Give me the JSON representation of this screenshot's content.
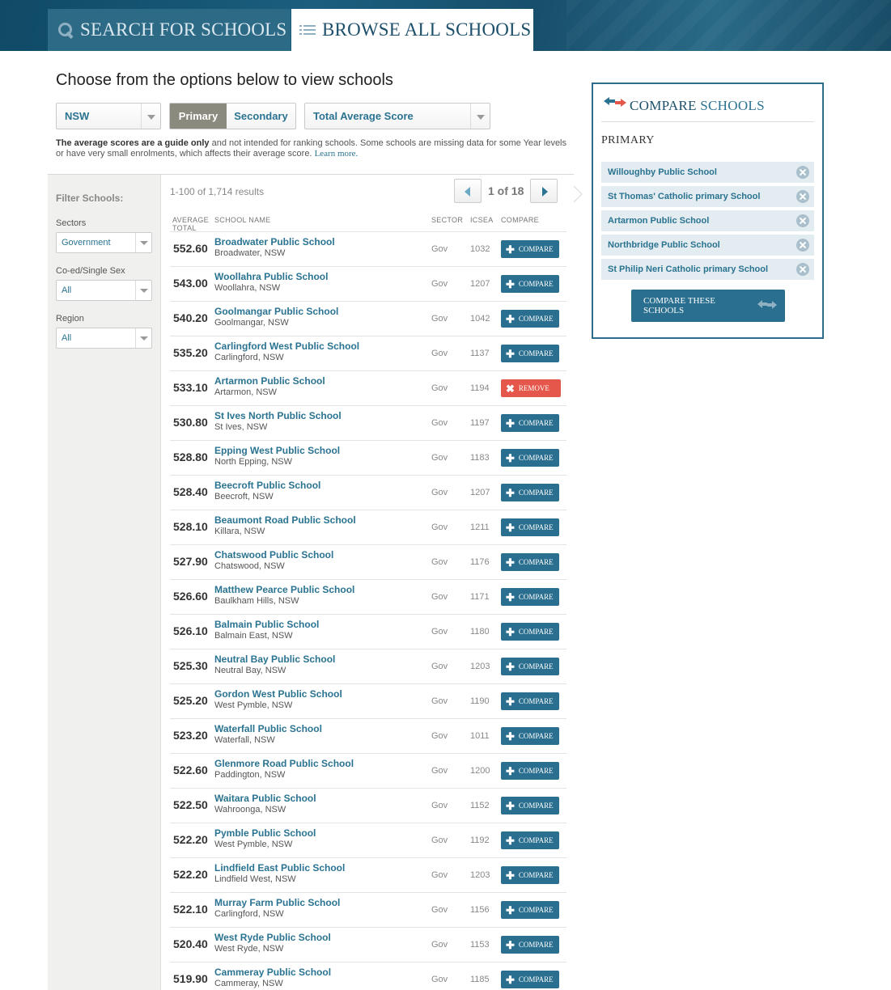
{
  "header": {
    "tabs": [
      {
        "label": "SEARCH FOR SCHOOLS",
        "icon": "search-icon",
        "active": false
      },
      {
        "label": "BROWSE ALL SCHOOLS",
        "icon": "list-icon",
        "active": true
      }
    ]
  },
  "main": {
    "title": "Choose from the options below to view schools",
    "state_select": "NSW",
    "level_toggle": {
      "primary": "Primary",
      "secondary": "Secondary",
      "selected": "Primary"
    },
    "score_select": "Total Average Score",
    "note": {
      "bold": "The average scores are a guide only",
      "rest": " and not intended for ranking schools. Some schools are missing data for some Year levels or have very small enrolments, which affects their average score. ",
      "link": "Learn more."
    }
  },
  "filters": {
    "title": "Filter Schools:",
    "sectors": {
      "label": "Sectors",
      "value": "Government"
    },
    "coed": {
      "label": "Co-ed/Single Sex",
      "value": "All"
    },
    "region": {
      "label": "Region",
      "value": "All"
    }
  },
  "results": {
    "count": "1-100 of 1,714 results",
    "page": "1 of 18",
    "headers": {
      "average_line1": "AVERAGE",
      "average_line2": "TOTAL",
      "name": "SCHOOL NAME",
      "sector": "SECTOR",
      "icsea": "ICSEA",
      "compare": "COMPARE"
    },
    "compare_label": "COMPARE",
    "remove_label": "REMOVE",
    "rows": [
      {
        "score": "552.60",
        "name": "Broadwater Public School",
        "loc": "Broadwater, NSW",
        "sector": "Gov",
        "icsea": "1032",
        "action": "COMPARE"
      },
      {
        "score": "543.00",
        "name": "Woollahra Public School",
        "loc": "Woollahra, NSW",
        "sector": "Gov",
        "icsea": "1207",
        "action": "COMPARE"
      },
      {
        "score": "540.20",
        "name": "Goolmangar Public School",
        "loc": "Goolmangar, NSW",
        "sector": "Gov",
        "icsea": "1042",
        "action": "COMPARE"
      },
      {
        "score": "535.20",
        "name": "Carlingford West Public School",
        "loc": "Carlingford, NSW",
        "sector": "Gov",
        "icsea": "1137",
        "action": "COMPARE"
      },
      {
        "score": "533.10",
        "name": "Artarmon Public School",
        "loc": "Artarmon, NSW",
        "sector": "Gov",
        "icsea": "1194",
        "action": "REMOVE"
      },
      {
        "score": "530.80",
        "name": "St Ives North Public School",
        "loc": "St Ives, NSW",
        "sector": "Gov",
        "icsea": "1197",
        "action": "COMPARE"
      },
      {
        "score": "528.80",
        "name": "Epping West Public School",
        "loc": "North Epping, NSW",
        "sector": "Gov",
        "icsea": "1183",
        "action": "COMPARE"
      },
      {
        "score": "528.40",
        "name": "Beecroft Public School",
        "loc": "Beecroft, NSW",
        "sector": "Gov",
        "icsea": "1207",
        "action": "COMPARE"
      },
      {
        "score": "528.10",
        "name": "Beaumont Road Public School",
        "loc": "Killara, NSW",
        "sector": "Gov",
        "icsea": "1211",
        "action": "COMPARE"
      },
      {
        "score": "527.90",
        "name": "Chatswood Public School",
        "loc": "Chatswood, NSW",
        "sector": "Gov",
        "icsea": "1176",
        "action": "COMPARE"
      },
      {
        "score": "526.60",
        "name": "Matthew Pearce Public School",
        "loc": "Baulkham Hills, NSW",
        "sector": "Gov",
        "icsea": "1171",
        "action": "COMPARE"
      },
      {
        "score": "526.10",
        "name": "Balmain Public School",
        "loc": "Balmain East, NSW",
        "sector": "Gov",
        "icsea": "1180",
        "action": "COMPARE"
      },
      {
        "score": "525.30",
        "name": "Neutral Bay Public School",
        "loc": "Neutral Bay, NSW",
        "sector": "Gov",
        "icsea": "1203",
        "action": "COMPARE"
      },
      {
        "score": "525.20",
        "name": "Gordon West Public School",
        "loc": "West Pymble, NSW",
        "sector": "Gov",
        "icsea": "1190",
        "action": "COMPARE"
      },
      {
        "score": "523.20",
        "name": "Waterfall Public School",
        "loc": "Waterfall, NSW",
        "sector": "Gov",
        "icsea": "1011",
        "action": "COMPARE"
      },
      {
        "score": "522.60",
        "name": "Glenmore Road Public School",
        "loc": "Paddington, NSW",
        "sector": "Gov",
        "icsea": "1200",
        "action": "COMPARE"
      },
      {
        "score": "522.50",
        "name": "Waitara Public School",
        "loc": "Wahroonga, NSW",
        "sector": "Gov",
        "icsea": "1152",
        "action": "COMPARE"
      },
      {
        "score": "522.20",
        "name": "Pymble Public School",
        "loc": "West Pymble, NSW",
        "sector": "Gov",
        "icsea": "1192",
        "action": "COMPARE"
      },
      {
        "score": "522.20",
        "name": "Lindfield East Public School",
        "loc": "Lindfield West, NSW",
        "sector": "Gov",
        "icsea": "1203",
        "action": "COMPARE"
      },
      {
        "score": "522.10",
        "name": "Murray Farm Public School",
        "loc": "Carlingford, NSW",
        "sector": "Gov",
        "icsea": "1156",
        "action": "COMPARE"
      },
      {
        "score": "520.40",
        "name": "West Ryde Public School",
        "loc": "West Ryde, NSW",
        "sector": "Gov",
        "icsea": "1153",
        "action": "COMPARE"
      },
      {
        "score": "519.90",
        "name": "Cammeray Public School",
        "loc": "Cammeray, NSW",
        "sector": "Gov",
        "icsea": "1185",
        "action": "COMPARE"
      }
    ]
  },
  "compare_panel": {
    "title_part1": "COMPARE",
    "title_part2": " SCHOOLS",
    "subtitle": "PRIMARY",
    "items": [
      "Willoughby Public School",
      "St Thomas' Catholic primary School",
      "Artarmon Public School",
      "Northbridge Public School",
      "St Philip Neri Catholic primary School"
    ],
    "button_line1": "COMPARE THESE",
    "button_line2": "SCHOOLS"
  },
  "colors": {
    "brand": "#1d4f6a",
    "accent": "#2a7391",
    "button": "#2a6f8f",
    "remove": "#e5574a"
  }
}
